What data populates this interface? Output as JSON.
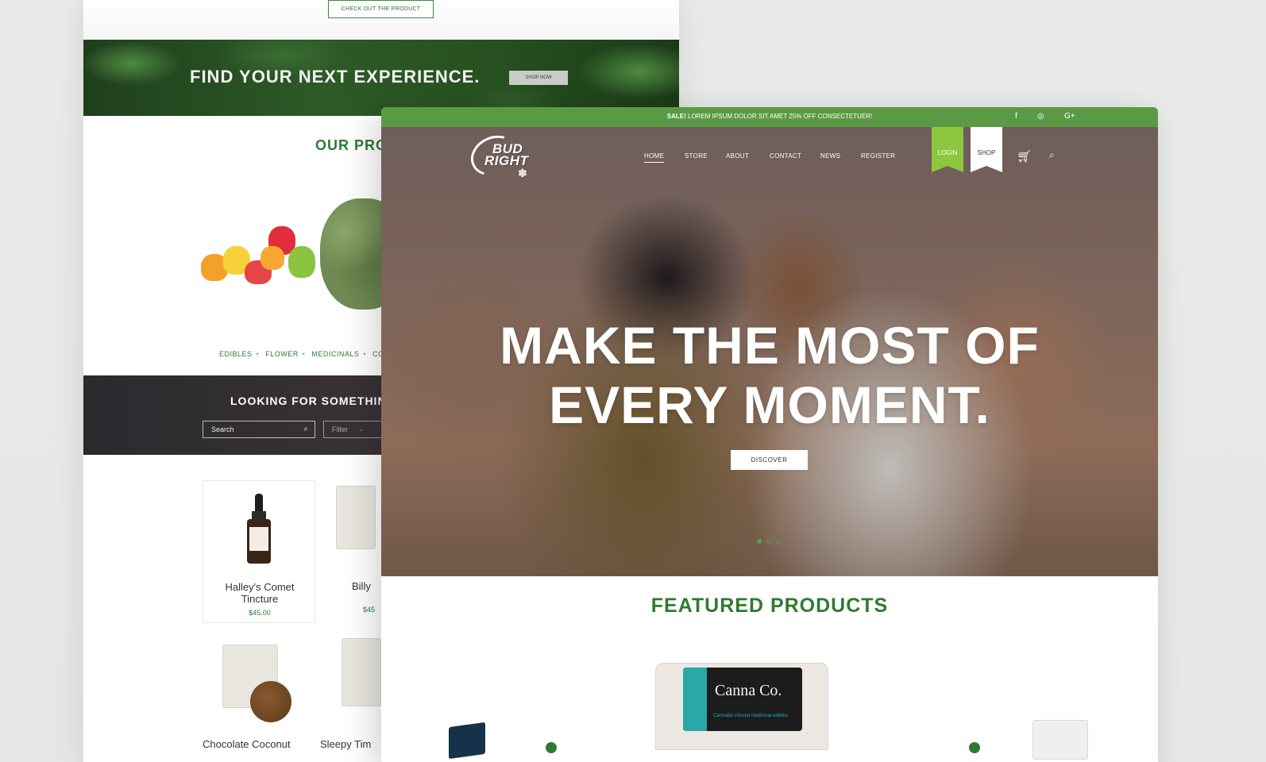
{
  "back_page": {
    "check_product_label": "CHECK OUT THE PRODUCT",
    "banner_text": "FIND YOUR NEXT EXPERIENCE.",
    "shop_now_label": "SHOP NOW",
    "our_products_title": "OUR PRO",
    "categories": [
      "EDIBLES",
      "FLOWER",
      "MEDICINALS",
      "CONC"
    ],
    "looking_title": "LOOKING FOR SOMETHIN",
    "search_placeholder": "Search",
    "filter_label": "Filter",
    "card": {
      "name_line1": "Halley's Comet",
      "name_line2": "Tincture",
      "price": "$45.00"
    },
    "partial_card": {
      "name": "Billy",
      "price": "$45"
    },
    "bottom_names": [
      "Chocolate Coconut",
      "Sleepy Tim"
    ]
  },
  "front_page": {
    "topbar": {
      "sale_bold": "SALE!",
      "sale_text": " LOREM IPSUM DOLOR SIT AMET 25% OFF CONSECTETUER!",
      "social": [
        {
          "icon": "facebook-icon",
          "glyph": "f"
        },
        {
          "icon": "instagram-icon",
          "glyph": "◎"
        },
        {
          "icon": "google-plus-icon",
          "glyph": "G+"
        }
      ]
    },
    "logo": {
      "line1": "BUD",
      "line2": "RIGHT"
    },
    "nav": [
      "HOME",
      "STORE",
      "ABOUT",
      "CONTACT",
      "NEWS",
      "REGISTER"
    ],
    "login_label": "LOGIN",
    "shop_label": "SHOP",
    "hero": {
      "title_line1": "MAKE THE MOST OF",
      "title_line2": "EVERY MOMENT.",
      "button": "DISCOVER",
      "slides": 3,
      "active_slide": 1
    },
    "featured_title": "FEATURED PRODUCTS",
    "featured_product": {
      "brand": "Canna Co.",
      "subtitle": "Cannabis infused medicinal edibles"
    }
  },
  "colors": {
    "brand_green": "#5b9a45",
    "title_green": "#2f7a31",
    "login_ribbon": "#8dc63f"
  }
}
